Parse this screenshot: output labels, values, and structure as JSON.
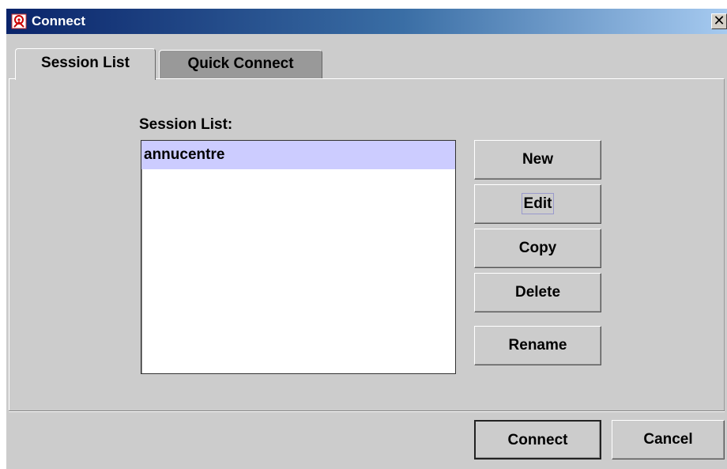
{
  "window": {
    "title": "Connect",
    "close_glyph": "✕"
  },
  "tabs": [
    {
      "label": "Session List",
      "active": true
    },
    {
      "label": "Quick Connect",
      "active": false
    }
  ],
  "session_panel": {
    "label": "Session List:",
    "items": [
      {
        "label": "annucentre",
        "selected": true
      }
    ]
  },
  "side_buttons": {
    "new": "New",
    "edit": "Edit",
    "copy": "Copy",
    "delete": "Delete",
    "rename": "Rename"
  },
  "footer": {
    "connect": "Connect",
    "cancel": "Cancel"
  },
  "icons": {
    "app": "app-logo-icon",
    "close": "close-icon"
  },
  "colors": {
    "title_gradient_start": "#0a246a",
    "title_gradient_end": "#a6caf0",
    "selection": "#ccccff",
    "window_bg": "#cccccc"
  }
}
